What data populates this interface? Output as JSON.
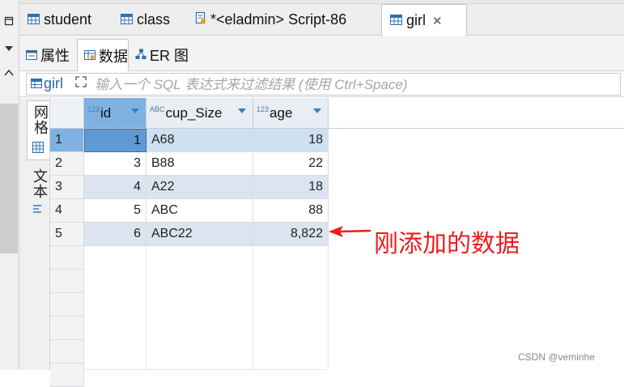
{
  "editor_tabs": [
    {
      "label": "student",
      "active": false
    },
    {
      "label": "class",
      "active": false
    },
    {
      "label": "*<eladmin> Script-86",
      "active": false
    },
    {
      "label": "girl",
      "active": true
    }
  ],
  "sub_tabs": [
    {
      "label": "属性",
      "active": false
    },
    {
      "label": "数据",
      "active": true
    },
    {
      "label": "ER 图",
      "active": false
    }
  ],
  "filter": {
    "table_name": "girl",
    "placeholder": "输入一个 SQL 表达式来过滤结果 (使用 Ctrl+Space)",
    "value": ""
  },
  "view_panel": {
    "grid_label": "网格",
    "text_label": "文本"
  },
  "grid": {
    "columns": [
      {
        "name": "id",
        "type_badge": "123"
      },
      {
        "name": "cup_Size",
        "type_badge": "ABC"
      },
      {
        "name": "age",
        "type_badge": "123"
      }
    ],
    "rows": [
      {
        "num": "1",
        "id": "1",
        "cup_size": "A68",
        "age": "18"
      },
      {
        "num": "2",
        "id": "3",
        "cup_size": "B88",
        "age": "22"
      },
      {
        "num": "3",
        "id": "4",
        "cup_size": "A22",
        "age": "18"
      },
      {
        "num": "4",
        "id": "5",
        "cup_size": "ABC",
        "age": "88"
      },
      {
        "num": "5",
        "id": "6",
        "cup_size": "ABC22",
        "age": "8,822"
      }
    ],
    "selected_row": 1
  },
  "annotation": {
    "text": "刚添加的数据",
    "color": "#ee1c1c"
  },
  "watermark": "CSDN @veminhe",
  "colors": {
    "selection": "#7fb2e0",
    "alt_row": "#dbe4ef",
    "header": "#e9eef4"
  }
}
